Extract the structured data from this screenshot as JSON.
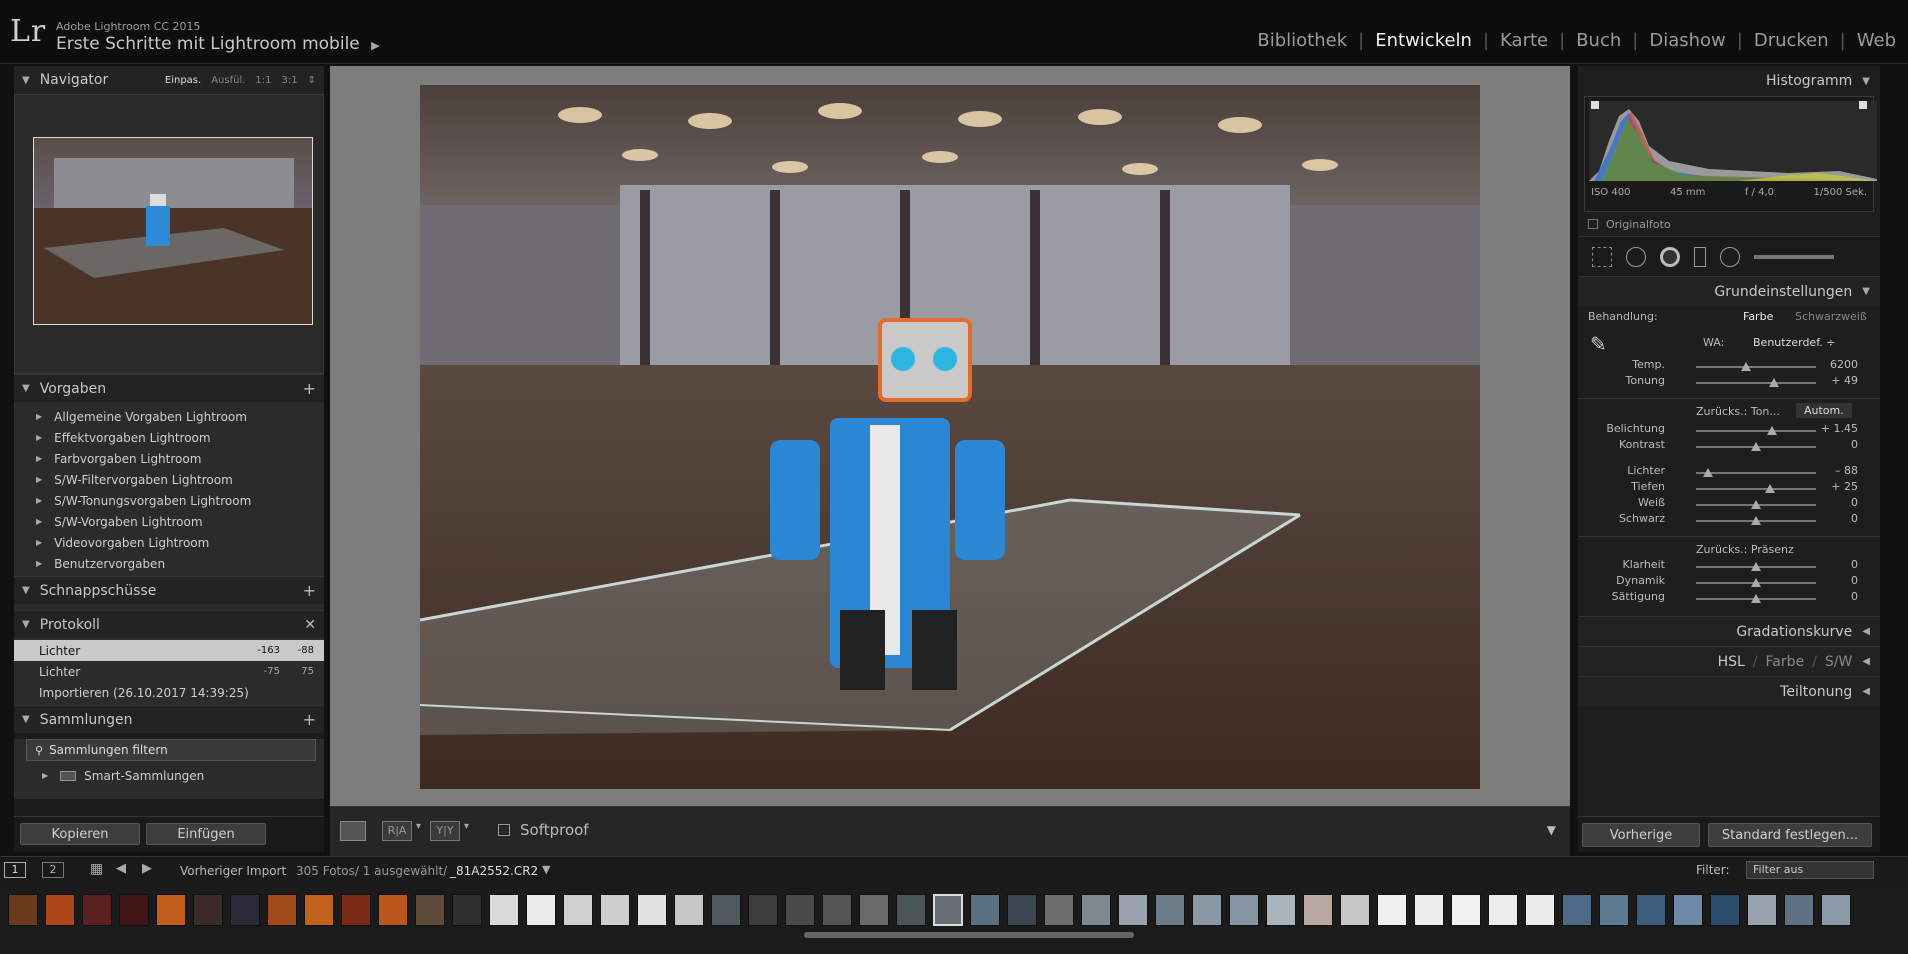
{
  "app": {
    "logo": "Lr",
    "version": "Adobe Lightroom CC 2015",
    "catalog": "Erste Schritte mit Lightroom mobile",
    "catalog_arrow": "▶"
  },
  "modules": [
    {
      "label": "Bibliothek",
      "active": false
    },
    {
      "label": "Entwickeln",
      "active": true
    },
    {
      "label": "Karte",
      "active": false
    },
    {
      "label": "Buch",
      "active": false
    },
    {
      "label": "Diashow",
      "active": false
    },
    {
      "label": "Drucken",
      "active": false
    },
    {
      "label": "Web",
      "active": false
    }
  ],
  "navigator": {
    "title": "Navigator",
    "opts": [
      "Einpas.",
      "Ausfül.",
      "1:1",
      "3:1"
    ]
  },
  "presets": {
    "title": "Vorgaben",
    "items": [
      "Allgemeine Vorgaben Lightroom",
      "Effektvorgaben Lightroom",
      "Farbvorgaben Lightroom",
      "S/W-Filtervorgaben Lightroom",
      "S/W-Tonungsvorgaben Lightroom",
      "S/W-Vorgaben Lightroom",
      "Videovorgaben Lightroom",
      "Benutzervorgaben"
    ]
  },
  "snapshots": {
    "title": "Schnappschüsse"
  },
  "history": {
    "title": "Protokoll",
    "items": [
      {
        "label": "Lichter",
        "a": "-163",
        "b": "-88",
        "selected": true
      },
      {
        "label": "Lichter",
        "a": "-75",
        "b": "75",
        "selected": false
      },
      {
        "label": "Importieren (26.10.2017 14:39:25)",
        "a": "",
        "b": "",
        "selected": false
      }
    ]
  },
  "collections": {
    "title": "Sammlungen",
    "filter": "Sammlungen filtern",
    "smart": "Smart-Sammlungen"
  },
  "left_buttons": {
    "copy": "Kopieren",
    "paste": "Einfügen"
  },
  "toolbar": {
    "softproof": "Softproof",
    "ra": "R|A",
    "yy": "Y|Y"
  },
  "histogram": {
    "title": "Histogramm",
    "iso": "ISO 400",
    "focal": "45 mm",
    "aperture": "f / 4,0",
    "shutter": "1/500 Sek.",
    "original": "Originalfoto"
  },
  "basic": {
    "title": "Grundeinstellungen",
    "treatment_label": "Behandlung:",
    "color": "Farbe",
    "bw": "Schwarzweiß",
    "wb_label": "WA:",
    "wb_value": "Benutzerdef. ÷",
    "tone_header": "Zurücks.: Ton...",
    "auto": "Autom.",
    "presence_header": "Zurücks.: Präsenz",
    "sliders_wb": [
      {
        "label": "Temp.",
        "value": "6200",
        "pos": 0.42
      },
      {
        "label": "Tonung",
        "value": "+ 49",
        "pos": 0.65
      }
    ],
    "sliders_tone": [
      {
        "label": "Belichtung",
        "value": "+ 1.45",
        "pos": 0.63
      },
      {
        "label": "Kontrast",
        "value": "0",
        "pos": 0.5
      }
    ],
    "sliders_tone2": [
      {
        "label": "Lichter",
        "value": "– 88",
        "pos": 0.1
      },
      {
        "label": "Tiefen",
        "value": "+ 25",
        "pos": 0.62
      },
      {
        "label": "Weiß",
        "value": "0",
        "pos": 0.5
      },
      {
        "label": "Schwarz",
        "value": "0",
        "pos": 0.5
      }
    ],
    "sliders_presence": [
      {
        "label": "Klarheit",
        "value": "0",
        "pos": 0.5
      },
      {
        "label": "Dynamik",
        "value": "0",
        "pos": 0.5
      },
      {
        "label": "Sättigung",
        "value": "0",
        "pos": 0.5
      }
    ]
  },
  "panels_collapsed": {
    "curve": "Gradationskurve",
    "hsl": "HSL",
    "farbe": "Farbe",
    "sw": "S/W",
    "split": "Teiltonung"
  },
  "right_buttons": {
    "prev": "Vorherige",
    "default": "Standard festlegen..."
  },
  "filmstrip": {
    "page1": "1",
    "page2": "2",
    "source": "Vorheriger Import",
    "count": "305 Fotos/ 1 ausgewählt/",
    "file": "_81A2552.CR2",
    "filter_label": "Filter:",
    "filter_value": "Filter aus"
  }
}
